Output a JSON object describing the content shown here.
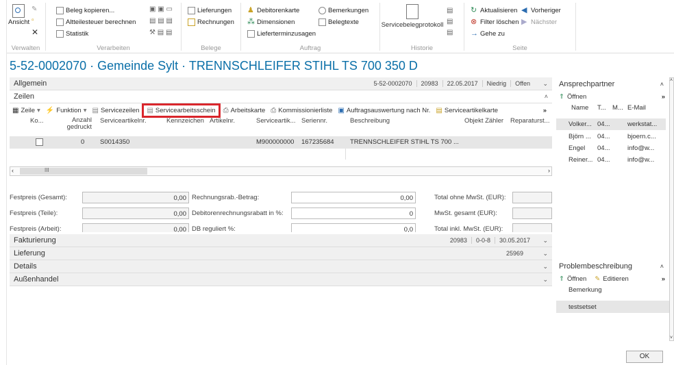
{
  "ribbon": {
    "groups": [
      {
        "label": "Verwalten"
      },
      {
        "label": "Verarbeiten"
      },
      {
        "label": "Belege"
      },
      {
        "label": "Auftrag"
      },
      {
        "label": "Historie"
      },
      {
        "label": "Seite"
      }
    ],
    "ansicht": "Ansicht",
    "beleg_kopieren": "Beleg kopieren...",
    "altteilesteuer": "Altteilesteuer berechnen",
    "statistik": "Statistik",
    "lieferungen": "Lieferungen",
    "rechnungen": "Rechnungen",
    "debitorenkarte": "Debitorenkarte",
    "dimensionen": "Dimensionen",
    "lieferterminzusagen": "Lieferterminzusagen",
    "bemerkungen": "Bemerkungen",
    "belegtexte": "Belegtexte",
    "servicebelegprotokoll": "Servicebelegprotokoll",
    "aktualisieren": "Aktualisieren",
    "vorheriger": "Vorheriger",
    "filter_loeschen": "Filter löschen",
    "naechster": "Nächster",
    "gehe_zu": "Gehe zu"
  },
  "page_title": "5-52-0002070 · Gemeinde Sylt · TRENNSCHLEIFER STIHL TS 700 350 D",
  "allgemein": {
    "label": "Allgemein",
    "summary": [
      "5-52-0002070",
      "20983",
      "22.05.2017",
      "Niedrig",
      "Offen"
    ]
  },
  "zeilen": {
    "label": "Zeilen",
    "actions": {
      "zeile": "Zeile",
      "funktion": "Funktion",
      "servicezeilen": "Servicezeilen",
      "servicearbeitsschein": "Servicearbeitsschein",
      "arbeitskarte": "Arbeitskarte",
      "kommissionierliste": "Kommissionierliste",
      "auftragsauswertung": "Auftragsauswertung nach Nr.",
      "serviceartikelkarte": "Serviceartikelkarte"
    },
    "columns": {
      "ko": "Ko...",
      "anzahl": "Anzahl gedruckt",
      "serviceartikelnr": "Serviceartikelnr.",
      "kennzeichen": "Kennzeichen",
      "artikelnr": "Artikelnr.",
      "serviceartik": "Serviceartik...",
      "seriennr": "Seriennr.",
      "beschreibung": "Beschreibung",
      "objekt_zaehler": "Objekt Zähler",
      "reparaturst": "Reparaturst..."
    },
    "row": {
      "anzahl": "0",
      "serviceartikelnr": "S0014350",
      "serviceartik": "M900000000",
      "seriennr": "167235684",
      "beschreibung": "TRENNSCHLEIFER STIHL TS 700 ..."
    },
    "scroll_mid": "III"
  },
  "totals": {
    "festpreis_gesamt": "Festpreis (Gesamt):",
    "festpreis_gesamt_val": "0,00",
    "festpreis_teile": "Festpreis (Teile):",
    "festpreis_teile_val": "0,00",
    "festpreis_arbeit": "Festpreis (Arbeit):",
    "festpreis_arbeit_val": "0,00",
    "rechnungsrab": "Rechnungsrab.-Betrag:",
    "rechnungsrab_val": "0,00",
    "debitorenrab": "Debitorenrechnungsrabatt in %:",
    "debitorenrab_val": "0",
    "db_reguliert": "DB reguliert %:",
    "db_reguliert_val": "0,0",
    "total_ohne": "Total ohne MwSt. (EUR):",
    "mwst_gesamt": "MwSt. gesamt (EUR):",
    "total_inkl": "Total inkl. MwSt. (EUR):"
  },
  "fakturierung": {
    "label": "Fakturierung",
    "summary": [
      "20983",
      "0-0-8",
      "30.05.2017"
    ]
  },
  "lieferung": {
    "label": "Lieferung",
    "summary": [
      "25969"
    ]
  },
  "details": {
    "label": "Details"
  },
  "aussenhandel": {
    "label": "Außenhandel"
  },
  "ansprechpartner": {
    "title": "Ansprechpartner",
    "oeffnen": "Öffnen",
    "cols": [
      "Name",
      "T...",
      "M...",
      "E-Mail"
    ],
    "rows": [
      [
        "Volker...",
        "04...",
        "werkstat..."
      ],
      [
        "Björn ...",
        "04...",
        "bjoern.c..."
      ],
      [
        "Engel",
        "04...",
        "info@w..."
      ],
      [
        "Reiner...",
        "04...",
        "info@w..."
      ]
    ]
  },
  "problem": {
    "title": "Problembeschreibung",
    "oeffnen": "Öffnen",
    "editieren": "Editieren",
    "bemerkung_label": "Bemerkung",
    "bemerkung_value": "testsetset"
  },
  "ok": "OK"
}
